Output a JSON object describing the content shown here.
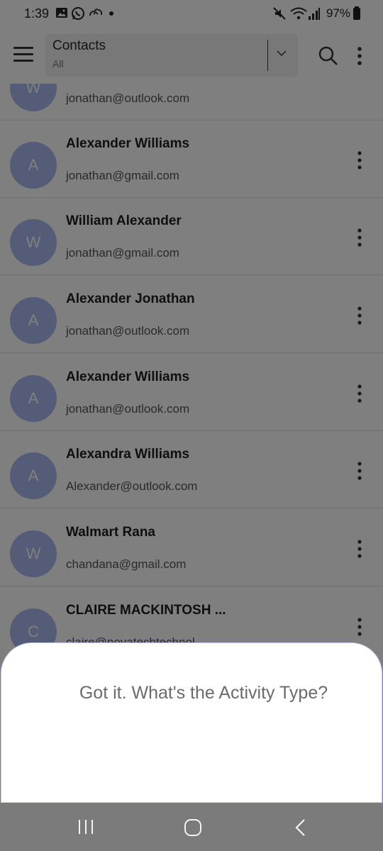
{
  "status_bar": {
    "time": "1:39",
    "battery": "97%",
    "icons": [
      "gallery-icon",
      "whatsapp-icon",
      "cloud-icon",
      "dot-icon",
      "mute-icon",
      "wifi-icon",
      "signal-icon",
      "battery-icon"
    ]
  },
  "app_bar": {
    "title": "Contacts",
    "subtitle": "All",
    "icons": [
      "menu-icon",
      "chevron-down-icon",
      "search-icon",
      "more-vert-icon"
    ]
  },
  "contacts": [
    {
      "initial": "W",
      "name": "",
      "email": "jonathan@outlook.com"
    },
    {
      "initial": "A",
      "name": "Alexander Williams",
      "email": "jonathan@gmail.com"
    },
    {
      "initial": "W",
      "name": "William Alexander",
      "email": "jonathan@gmail.com"
    },
    {
      "initial": "A",
      "name": "Alexander Jonathan",
      "email": "jonathan@outlook.com"
    },
    {
      "initial": "A",
      "name": "Alexander Williams",
      "email": "jonathan@outlook.com"
    },
    {
      "initial": "A",
      "name": "Alexandra Williams",
      "email": "Alexander@outlook.com"
    },
    {
      "initial": "W",
      "name": "Walmart Rana",
      "email": "chandana@gmail.com"
    },
    {
      "initial": "C",
      "name": "CLAIRE MACKINTOSH ...",
      "email": "claire@novatechtechnol"
    }
  ],
  "sheet": {
    "question": "Got it. What's the Activity Type?"
  },
  "nav_bar": {
    "icons": [
      "recent-apps-icon",
      "home-icon",
      "back-icon"
    ]
  },
  "colors": {
    "avatar": "#a9b9ef",
    "overlay": "rgba(0,0,0,0.5)",
    "nav_bar": "#7b7b7b"
  }
}
